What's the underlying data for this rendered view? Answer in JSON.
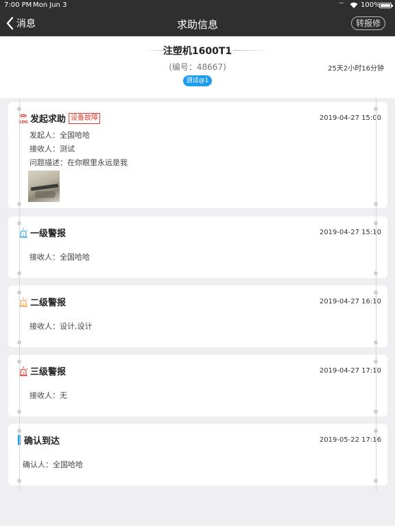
{
  "status_bar": {
    "time": "7:00 PM",
    "date": "Mon Jun 3",
    "battery": "100%"
  },
  "nav": {
    "back_label": "消息",
    "title": "求助信息",
    "transfer_button": "转报修"
  },
  "header": {
    "machine_name": "注塑机1600T1",
    "serial": "(编号：48667)",
    "elapsed": "25天2小时16分钟",
    "tag": "测试@1"
  },
  "cards": [
    {
      "icon": "sos-icon",
      "title": "发起求助",
      "badge": "设备故障",
      "time": "2019-04-27 15:00",
      "lines": [
        "发起人：全国哈哈",
        "接收人：测试",
        "问题描述：在你眼里永远是我"
      ],
      "has_photo": true
    },
    {
      "icon": "alarm-level-1-icon",
      "title": "一级警报",
      "time": "2019-04-27 15:10",
      "lines": [
        "接收人：全国哈哈"
      ]
    },
    {
      "icon": "alarm-level-2-icon",
      "title": "二级警报",
      "time": "2019-04-27 16:10",
      "lines": [
        "接收人：设计,设计"
      ]
    },
    {
      "icon": "alarm-level-3-icon",
      "title": "三级警报",
      "time": "2019-04-27 17:10",
      "lines": [
        "接收人：无"
      ]
    },
    {
      "icon": "arrival-bar-icon",
      "title": "确认到达",
      "time": "2019-05-22 17:16",
      "lines": [
        "确认人：全国哈哈"
      ]
    }
  ],
  "colors": {
    "nav_bg": "#2f2f2f",
    "accent_blue": "#1e9cf0",
    "alarm_red": "#e23b2f",
    "alarm_orange": "#f5a04a",
    "alarm_cyan": "#39a8e0"
  }
}
